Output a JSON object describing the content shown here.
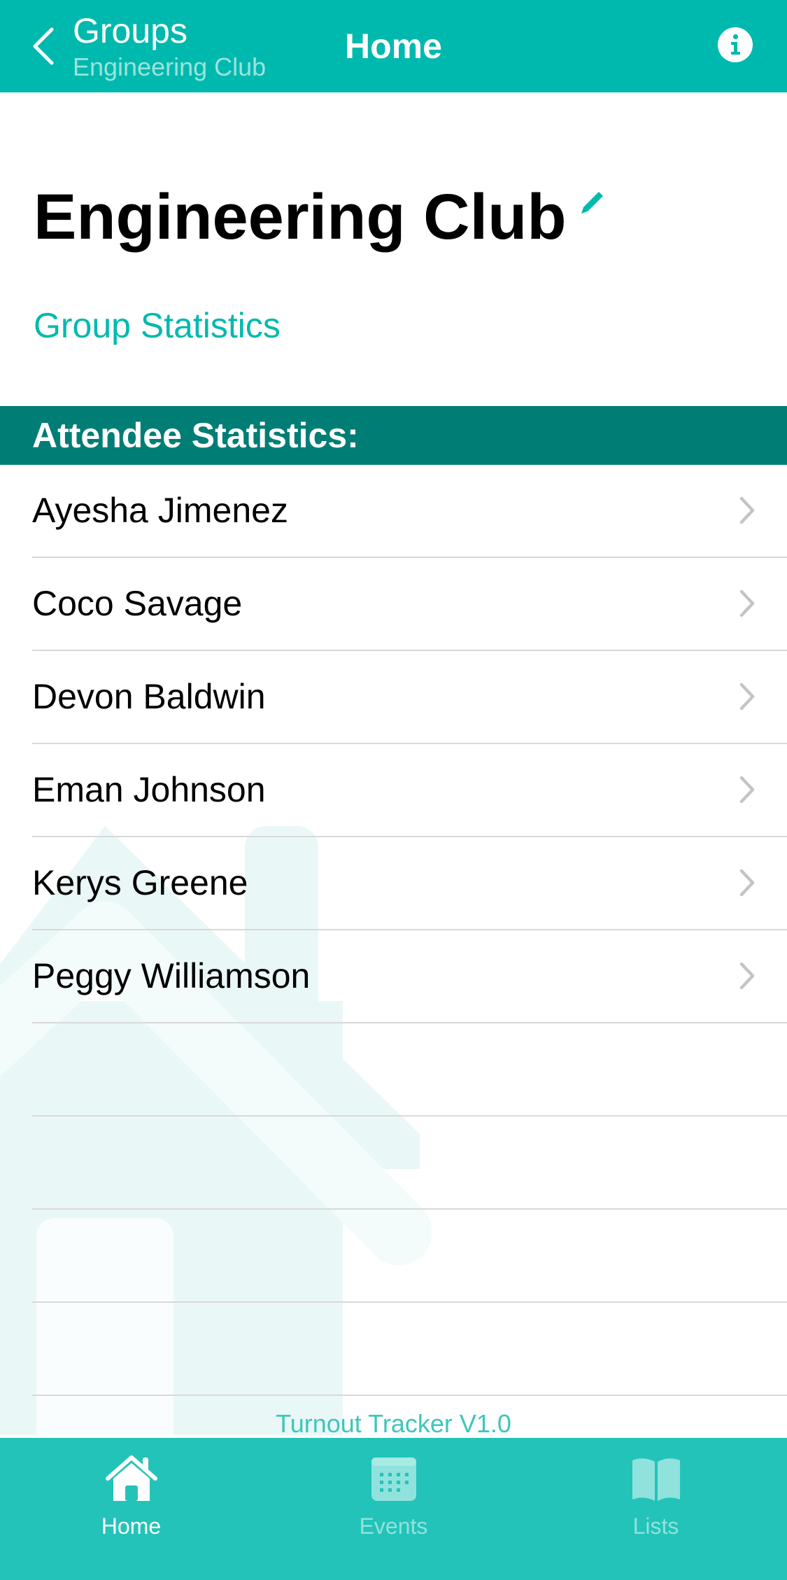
{
  "nav": {
    "back_label": "Groups",
    "back_subtitle": "Engineering Club",
    "title": "Home"
  },
  "group": {
    "name": "Engineering Club",
    "stats_link": "Group Statistics"
  },
  "attendee_section": {
    "header": "Attendee Statistics:",
    "attendees": [
      {
        "name": "Ayesha Jimenez"
      },
      {
        "name": "Coco Savage"
      },
      {
        "name": "Devon Baldwin"
      },
      {
        "name": "Eman Johnson"
      },
      {
        "name": "Kerys Greene"
      },
      {
        "name": "Peggy Williamson"
      }
    ]
  },
  "footer": {
    "version": "Turnout Tracker V1.0"
  },
  "tabbar": {
    "tabs": [
      {
        "label": "Home",
        "icon": "house-icon",
        "active": true
      },
      {
        "label": "Events",
        "icon": "calendar-icon",
        "active": false
      },
      {
        "label": "Lists",
        "icon": "book-icon",
        "active": false
      }
    ]
  },
  "colors": {
    "accent": "#00b9ae",
    "section_header": "#007d75",
    "tabbar": "#23c3b9",
    "inactive_tab": "#8fe3dc"
  }
}
